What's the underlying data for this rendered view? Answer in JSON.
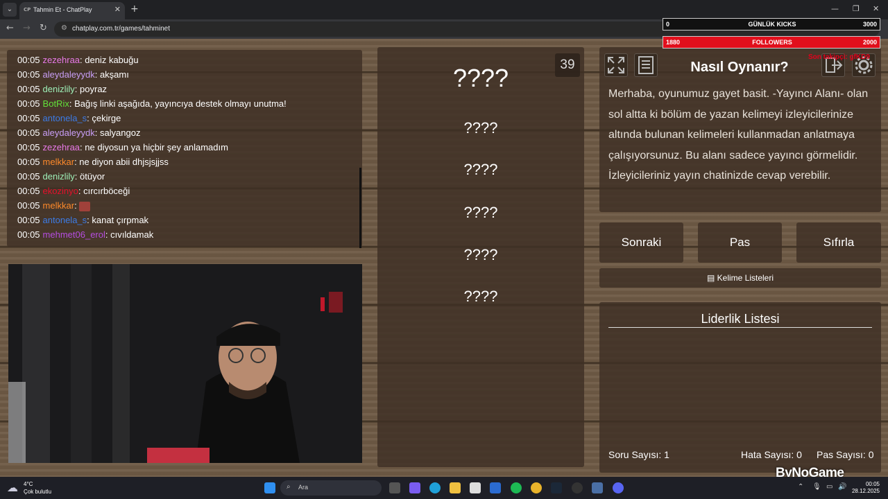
{
  "browser": {
    "tab_title": "Tahmin Et - ChatPlay",
    "tab_favicon": "CP",
    "url": "chatplay.com.tr/games/tahminet"
  },
  "overlay": {
    "kicks": {
      "left": "0",
      "label": "GÜNLÜK KICKS",
      "right": "3000"
    },
    "followers": {
      "left": "1880",
      "label": "FOLLOWERS",
      "right": "2000"
    },
    "red_text": "Son takipçi: gfKD9"
  },
  "chat": {
    "messages": [
      {
        "time": "00:05",
        "user": "zezehraa",
        "color": "#e879e8",
        "text": "deniz kabuğu"
      },
      {
        "time": "00:05",
        "user": "aleydaleyydk",
        "color": "#c79df5",
        "text": "akşamı"
      },
      {
        "time": "00:05",
        "user": "denizlily",
        "color": "#9ef0b8",
        "text": "poyraz"
      },
      {
        "time": "00:05",
        "user": "BotRix",
        "color": "#63e23a",
        "text": "Bağış linki aşağıda, yayıncıya destek olmayı unutma!"
      },
      {
        "time": "00:05",
        "user": "antonela_s",
        "color": "#3c7be6",
        "text": "çekirge"
      },
      {
        "time": "00:05",
        "user": "aleydaleyydk",
        "color": "#c79df5",
        "text": "salyangoz"
      },
      {
        "time": "00:05",
        "user": "zezehraa",
        "color": "#e879e8",
        "text": "ne diyosun ya hiçbir şey anlamadım"
      },
      {
        "time": "00:05",
        "user": "melkkar",
        "color": "#ff8a2a",
        "text": "ne diyon abii dhjsjsjjss"
      },
      {
        "time": "00:05",
        "user": "denizlily",
        "color": "#9ef0b8",
        "text": "ötüyor"
      },
      {
        "time": "00:05",
        "user": "ekozinyo",
        "color": "#e3112b",
        "text": "cırcırböceği"
      },
      {
        "time": "00:05",
        "user": "melkkar",
        "color": "#ff8a2a",
        "text": ""
      },
      {
        "time": "00:05",
        "user": "antonela_s",
        "color": "#3c7be6",
        "text": "kanat çırpmak"
      },
      {
        "time": "00:05",
        "user": "mehmet06_erol",
        "color": "#b54de0",
        "text": "cıvıldamak"
      }
    ]
  },
  "game": {
    "counter": "39",
    "words": [
      "????",
      "????",
      "????",
      "????",
      "????",
      "????"
    ]
  },
  "how_to": {
    "title": "Nasıl Oynanır?",
    "text": "Merhaba, oyunumuz gayet basit. -Yayıncı Alanı- olan sol altta ki bölüm de yazan kelimeyi izleyicilerinize altında bulunan kelimeleri kullanmadan anlatmaya çalışıyorsunuz. Bu alanı sadece yayıncı görmelidir. İzleyicileriniz yayın chatinizde cevap verebilir."
  },
  "controls": {
    "next": "Sonraki",
    "pass": "Pas",
    "reset": "Sıfırla",
    "word_lists": "Kelime Listeleri"
  },
  "leaderboard": {
    "title": "Liderlik Listesi",
    "question_label": "Soru Sayısı:",
    "question_value": "1",
    "error_label": "Hata Sayısı:",
    "error_value": "0",
    "pass_label": "Pas Sayısı:",
    "pass_value": "0"
  },
  "taskbar": {
    "temperature": "4°C",
    "weather": "Çok bulutlu",
    "search_placeholder": "Ara",
    "time": "00:05",
    "date": "28.12.2025",
    "watermark": "ByNoGame"
  }
}
